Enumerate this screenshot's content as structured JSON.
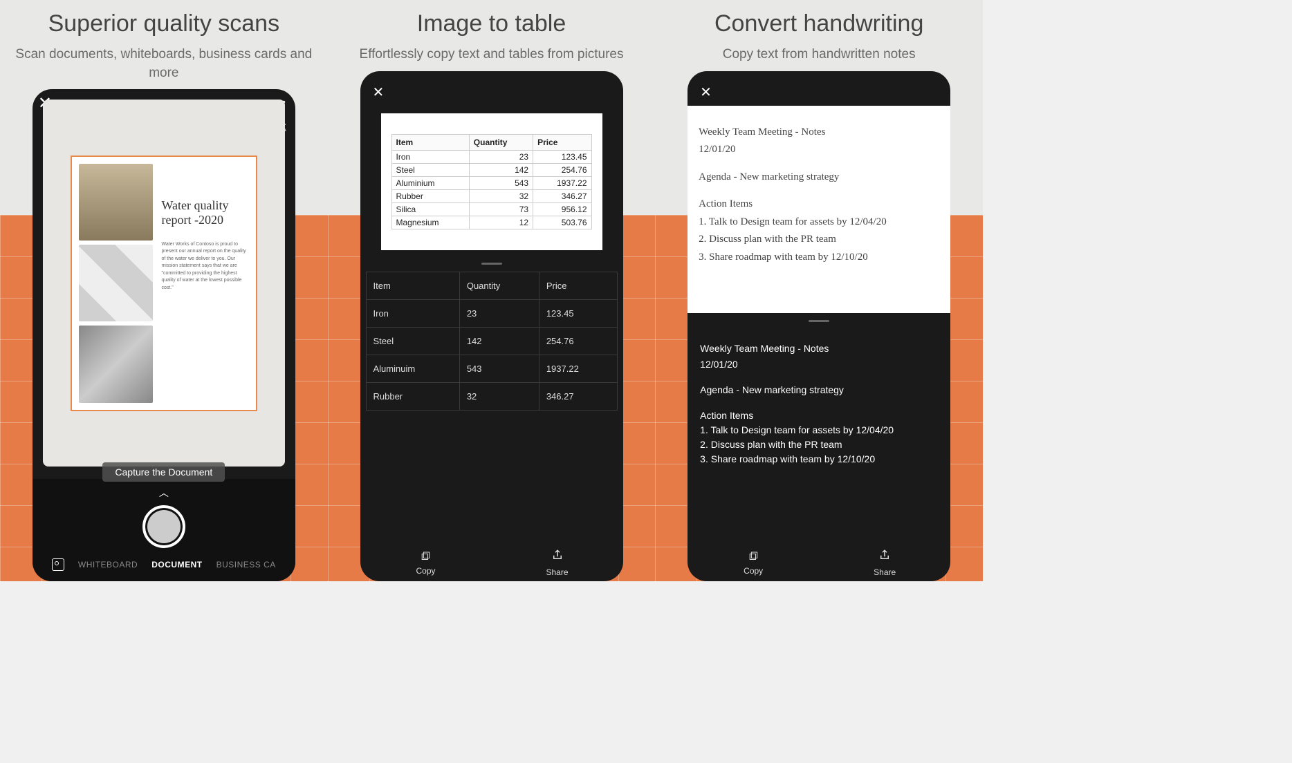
{
  "panel1": {
    "title": "Superior quality scans",
    "subtitle": "Scan documents, whiteboards, business cards and more",
    "doc_title": "Water quality report -2020",
    "doc_body": "Water Works of Contoso is proud to present our annual report on the quality of the water we deliver to you. Our mission statement says that we are \"committed to providing the highest quality of water at the lowest possible cost.\"",
    "hint": "Capture the Document",
    "modes": {
      "whiteboard": "WHITEBOARD",
      "document": "DOCUMENT",
      "business_card": "BUSINESS CA"
    }
  },
  "panel2": {
    "title": "Image to table",
    "subtitle": "Effortlessly copy text and tables from pictures",
    "source_table": {
      "headers": [
        "Item",
        "Quantity",
        "Price"
      ],
      "rows": [
        [
          "Iron",
          "23",
          "123.45"
        ],
        [
          "Steel",
          "142",
          "254.76"
        ],
        [
          "Aluminium",
          "543",
          "1937.22"
        ],
        [
          "Rubber",
          "32",
          "346.27"
        ],
        [
          "Silica",
          "73",
          "956.12"
        ],
        [
          "Magnesium",
          "12",
          "503.76"
        ]
      ]
    },
    "result_table": {
      "headers": [
        "Item",
        "Quantity",
        "Price"
      ],
      "rows": [
        [
          "Iron",
          "23",
          "123.45"
        ],
        [
          "Steel",
          "142",
          "254.76"
        ],
        [
          "Aluminuim",
          "543",
          "1937.22"
        ],
        [
          "Rubber",
          "32",
          "346.27"
        ]
      ]
    },
    "actions": {
      "copy": "Copy",
      "share": "Share"
    }
  },
  "panel3": {
    "title": "Convert handwriting",
    "subtitle": "Copy text from handwritten notes",
    "hw": {
      "line1": "Weekly Team Meeting - Notes",
      "line2": "12/01/20",
      "agenda": "Agenda - New marketing strategy",
      "ai_head": "Action Items",
      "ai1": "1. Talk to Design team for assets by 12/04/20",
      "ai2": "2. Discuss plan with the PR team",
      "ai3": "3. Share roadmap with team by 12/10/20"
    },
    "result": {
      "line1": "Weekly Team Meeting - Notes",
      "line2": "12/01/20",
      "agenda": "Agenda - New marketing strategy",
      "ai_head": "Action Items",
      "ai1": "1. Talk to Design team for assets by 12/04/20",
      "ai2": "2. Discuss plan with the PR team",
      "ai3": "3. Share roadmap with team by 12/10/20"
    },
    "actions": {
      "copy": "Copy",
      "share": "Share"
    }
  }
}
